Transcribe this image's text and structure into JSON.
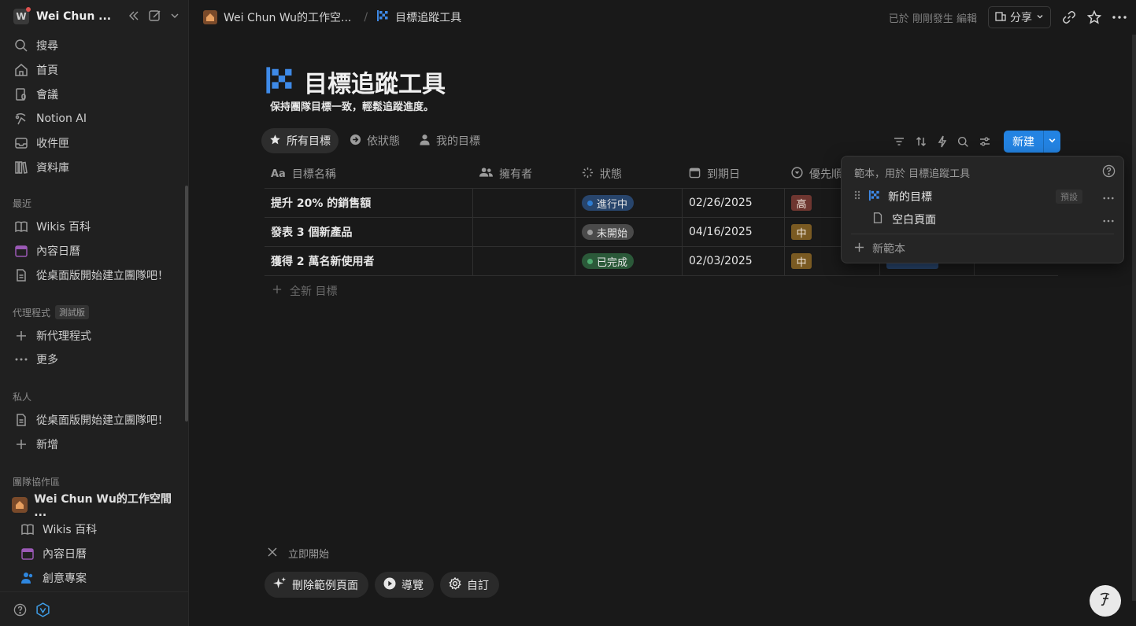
{
  "sidebar": {
    "workspace_initial": "W",
    "workspace_name": "Wei Chun ...",
    "nav": [
      {
        "label": "搜尋",
        "icon": "search-icon"
      },
      {
        "label": "首頁",
        "icon": "home-icon"
      },
      {
        "label": "會議",
        "icon": "meeting-icon"
      },
      {
        "label": "Notion AI",
        "icon": "notion-ai-icon"
      },
      {
        "label": "收件匣",
        "icon": "inbox-icon"
      },
      {
        "label": "資料庫",
        "icon": "library-icon"
      }
    ],
    "recent_label": "最近",
    "recent": [
      {
        "label": "Wikis 百科",
        "icon": "book-icon"
      },
      {
        "label": "內容日曆",
        "icon": "calendar-icon"
      },
      {
        "label": "從桌面版開始建立團隊吧！",
        "icon": "page-icon"
      }
    ],
    "agents_label": "代理程式",
    "agents_badge": "測試版",
    "agents": [
      {
        "label": "新代理程式",
        "icon": "plus-icon"
      },
      {
        "label": "更多",
        "icon": "more-icon"
      }
    ],
    "private_label": "私人",
    "private": [
      {
        "label": "從桌面版開始建立團隊吧！",
        "icon": "page-icon"
      },
      {
        "label": "新增",
        "icon": "plus-icon"
      }
    ],
    "teamspace_label": "團隊協作區",
    "teamspace_name": "Wei Chun Wu的工作空間 ...",
    "teamspace_items": [
      {
        "label": "Wikis 百科",
        "icon": "book-icon"
      },
      {
        "label": "內容日曆",
        "icon": "calendar-icon"
      },
      {
        "label": "創意專案",
        "icon": "people-icon"
      }
    ]
  },
  "topbar": {
    "breadcrumb_workspace": "Wei Chun Wu的工作空...",
    "breadcrumb_sep": "/",
    "breadcrumb_page": "目標追蹤工具",
    "edited": "已於 剛剛發生 編輯",
    "share": "分享"
  },
  "page": {
    "title": "目標追蹤工具",
    "description": "保持團隊目標一致，輕鬆追蹤進度。",
    "views": [
      {
        "label": "所有目標",
        "icon": "star-icon",
        "active": true
      },
      {
        "label": "依狀態",
        "icon": "arrow-circle-icon",
        "active": false
      },
      {
        "label": "我的目標",
        "icon": "person-icon",
        "active": false
      }
    ],
    "new_button": "新建"
  },
  "table": {
    "headers": [
      {
        "label": "目標名稱",
        "icon": "Aa"
      },
      {
        "label": "擁有者",
        "icon": "people-icon"
      },
      {
        "label": "狀態",
        "icon": "status-icon"
      },
      {
        "label": "到期日",
        "icon": "calendar-icon"
      },
      {
        "label": "優先順",
        "icon": "priority-icon"
      }
    ],
    "rows": [
      {
        "title": "提升 20% 的銷售額",
        "status": "進行中",
        "status_color": "#28456c",
        "status_dot": "#2e7cd1",
        "due": "02/26/2025",
        "priority": "高",
        "priority_color": "#6e3630"
      },
      {
        "title": "發表 3 個新產品",
        "status": "未開始",
        "status_color": "#4a4a4a",
        "status_dot": "#9b9b9b",
        "due": "04/16/2025",
        "priority": "中",
        "priority_color": "#7a5a22"
      },
      {
        "title": "獲得 2 萬名新使用者",
        "status": "已完成",
        "status_color": "#2b5939",
        "status_dot": "#4dab6f",
        "due": "02/03/2025",
        "priority": "中",
        "priority_color": "#7a5a22"
      }
    ],
    "add_row": "全新 目標"
  },
  "popup": {
    "heading": "範本，用於 目標追蹤工具",
    "templates": [
      {
        "label": "新的目標",
        "badge": "預設"
      },
      {
        "label": "空白頁面"
      }
    ],
    "new_template": "新範本"
  },
  "getting_started": {
    "label": "立即開始",
    "buttons": [
      {
        "label": "刪除範例頁面",
        "icon": "sparkle-icon"
      },
      {
        "label": "導覽",
        "icon": "play-icon"
      },
      {
        "label": "自訂",
        "icon": "gear-icon"
      }
    ]
  },
  "colors": {
    "accent": "#2383e2",
    "background": "#191919",
    "sidebar": "#202020"
  }
}
